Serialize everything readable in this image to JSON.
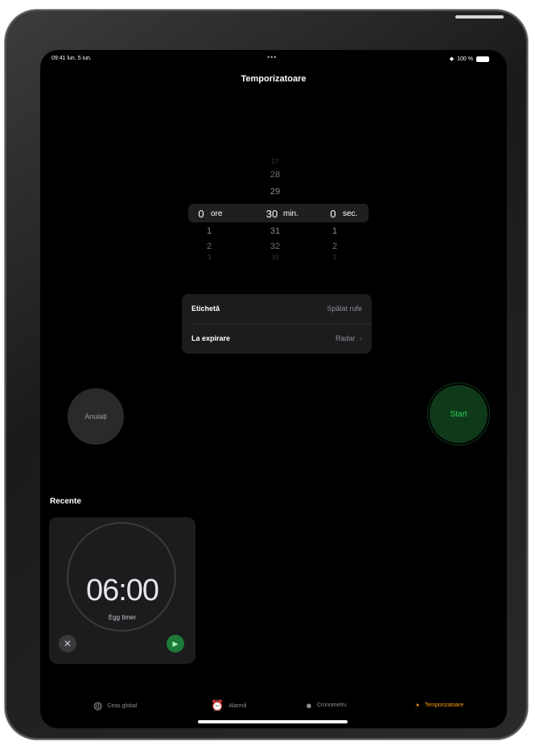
{
  "status_bar": {
    "time": "09:41 lun. 5 iun.",
    "dots": "•••",
    "battery": "100 %"
  },
  "page_title": "Temporizatoare",
  "picker": {
    "hours": {
      "above": [],
      "selected": "0",
      "unit": "ore",
      "below": [
        "1",
        "2",
        "3"
      ]
    },
    "minutes": {
      "above": [
        "27",
        "28",
        "29"
      ],
      "selected": "30",
      "unit": "min.",
      "below": [
        "31",
        "32",
        "33"
      ]
    },
    "seconds": {
      "above": [],
      "selected": "0",
      "unit": "sec.",
      "below": [
        "1",
        "2",
        "3"
      ]
    }
  },
  "settings": {
    "label_row": {
      "label": "Etichetă",
      "value": "Spălat rufe"
    },
    "expire_row": {
      "label": "La expirare",
      "value": "Radar",
      "chevron": "›"
    }
  },
  "buttons": {
    "cancel": "Anulați",
    "start": "Start"
  },
  "recents": {
    "title": "Recente",
    "items": [
      {
        "time": "06:00",
        "label": "Egg timer"
      }
    ]
  },
  "tabs": [
    {
      "label": "Ceas global",
      "icon": "globe-icon"
    },
    {
      "label": "Alarmă",
      "icon": "alarm-clock-icon"
    },
    {
      "label": "Cronometru",
      "icon": "stopwatch-icon"
    },
    {
      "label": "Temporizatoare",
      "icon": "timer-icon",
      "active": true
    }
  ],
  "colors": {
    "accent": "#ff9f0a",
    "start_green": "#30d158",
    "background": "#000000"
  }
}
